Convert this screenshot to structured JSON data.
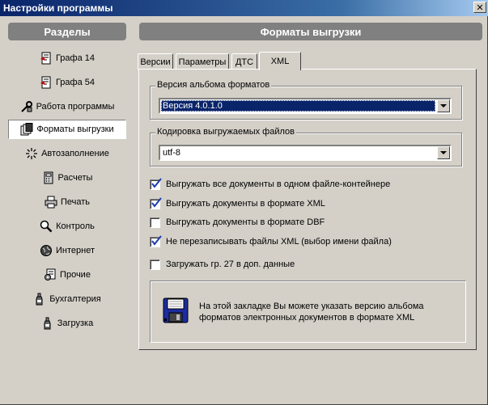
{
  "window": {
    "title": "Настройки программы",
    "close_glyph": "✕"
  },
  "sidebar": {
    "header": "Разделы",
    "active_index": 3,
    "items": [
      {
        "label": "Графа 14",
        "icon": "form-icon"
      },
      {
        "label": "Графа 54",
        "icon": "form-icon"
      },
      {
        "label": "Работа программы",
        "icon": "tools-icon"
      },
      {
        "label": "Форматы выгрузки",
        "icon": "documents-icon"
      },
      {
        "label": "Автозаполнение",
        "icon": "sparkle-icon"
      },
      {
        "label": "Расчеты",
        "icon": "calculator-icon"
      },
      {
        "label": "Печать",
        "icon": "printer-icon"
      },
      {
        "label": "Контроль",
        "icon": "magnifier-icon"
      },
      {
        "label": "Интернет",
        "icon": "globe-icon"
      },
      {
        "label": "Прочие",
        "icon": "settings-sheet-icon"
      },
      {
        "label": "Бухгалтерия",
        "icon": "bottle-icon"
      },
      {
        "label": "Загрузка",
        "icon": "bottle-icon"
      }
    ]
  },
  "main": {
    "header": "Форматы выгрузки",
    "tabs": [
      {
        "label": "Версии"
      },
      {
        "label": "Параметры"
      },
      {
        "label": "ДТС"
      },
      {
        "label": "XML"
      }
    ],
    "active_tab": 3,
    "album_version": {
      "legend": "Версия альбома форматов",
      "value": "Версия 4.0.1.0"
    },
    "encoding": {
      "legend": "Кодировка выгружаемых файлов",
      "value": "utf-8"
    },
    "options": [
      {
        "label": "Выгружать все документы в одном файле-контейнере",
        "checked": true
      },
      {
        "label": "Выгружать документы в формате XML",
        "checked": true
      },
      {
        "label": "Выгружать документы в формате DBF",
        "checked": false
      },
      {
        "label": "Не перезаписывать файлы XML (выбор имени файла)",
        "checked": true
      },
      {
        "label": "Загружать гр. 27 в доп. данные",
        "checked": false
      }
    ],
    "info": {
      "icon": "floppy-disk-icon",
      "text_line1": "На этой закладке Вы можете указать версию альбома",
      "text_line2": "форматов электронных документов в формате XML"
    }
  },
  "colors": {
    "title_gradient_start": "#0a246a",
    "face": "#d4d0c8",
    "header_gray": "#808080",
    "selection": "#0a246a",
    "check_mark": "#1a3ab0"
  }
}
